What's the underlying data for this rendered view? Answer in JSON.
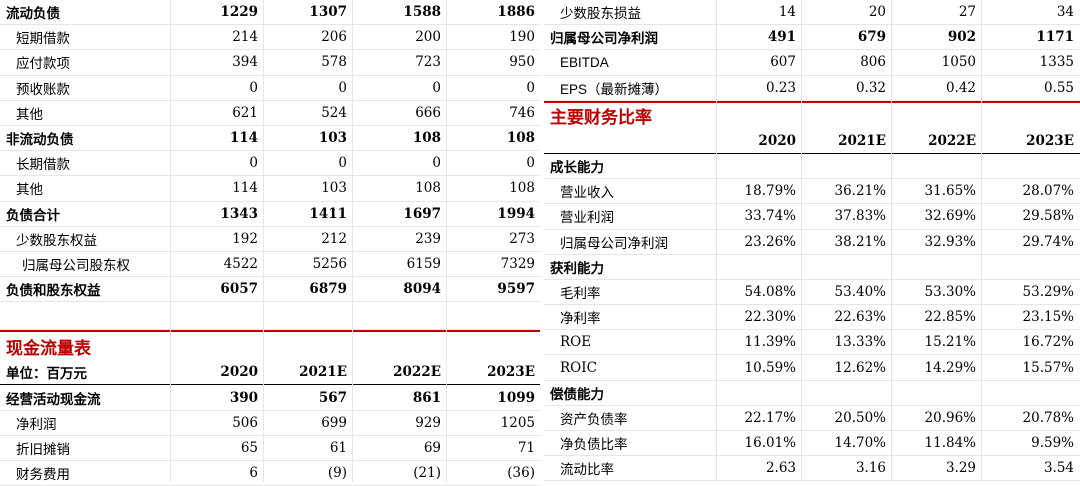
{
  "left": {
    "balance_rows": [
      {
        "label": "流动负债",
        "bold": true,
        "indent": 0,
        "values": [
          "1229",
          "1307",
          "1588",
          "1886"
        ]
      },
      {
        "label": "短期借款",
        "bold": false,
        "indent": 1,
        "values": [
          "214",
          "206",
          "200",
          "190"
        ]
      },
      {
        "label": "应付款项",
        "bold": false,
        "indent": 1,
        "values": [
          "394",
          "578",
          "723",
          "950"
        ]
      },
      {
        "label": "预收账款",
        "bold": false,
        "indent": 1,
        "values": [
          "0",
          "0",
          "0",
          "0"
        ]
      },
      {
        "label": "其他",
        "bold": false,
        "indent": 1,
        "values": [
          "621",
          "524",
          "666",
          "746"
        ]
      },
      {
        "label": "非流动负债",
        "bold": true,
        "indent": 0,
        "values": [
          "114",
          "103",
          "108",
          "108"
        ]
      },
      {
        "label": "长期借款",
        "bold": false,
        "indent": 1,
        "values": [
          "0",
          "0",
          "0",
          "0"
        ]
      },
      {
        "label": "其他",
        "bold": false,
        "indent": 1,
        "values": [
          "114",
          "103",
          "108",
          "108"
        ]
      },
      {
        "label": "负债合计",
        "bold": true,
        "indent": 0,
        "values": [
          "1343",
          "1411",
          "1697",
          "1994"
        ]
      },
      {
        "label": "少数股东权益",
        "bold": false,
        "indent": 1,
        "values": [
          "192",
          "212",
          "239",
          "273"
        ]
      },
      {
        "label": "归属母公司股东权",
        "bold": false,
        "indent": 2,
        "values": [
          "4522",
          "5256",
          "6159",
          "7329"
        ]
      },
      {
        "label": "负债和股东权益",
        "bold": true,
        "indent": 0,
        "values": [
          "6057",
          "6879",
          "8094",
          "9597"
        ]
      }
    ],
    "cashflow_title": "现金流量表",
    "cashflow_header": {
      "label": "单位：百万元",
      "years": [
        "2020",
        "2021E",
        "2022E",
        "2023E"
      ]
    },
    "cashflow_rows": [
      {
        "label": "经营活动现金流",
        "bold": true,
        "indent": 0,
        "values": [
          "390",
          "567",
          "861",
          "1099"
        ]
      },
      {
        "label": "净利润",
        "bold": false,
        "indent": 1,
        "values": [
          "506",
          "699",
          "929",
          "1205"
        ]
      },
      {
        "label": "折旧摊销",
        "bold": false,
        "indent": 1,
        "values": [
          "65",
          "61",
          "69",
          "71"
        ]
      },
      {
        "label": "财务费用",
        "bold": false,
        "indent": 1,
        "values": [
          "6",
          "(9)",
          "(21)",
          "(36)"
        ]
      }
    ]
  },
  "right": {
    "top_rows": [
      {
        "label": "少数股东损益",
        "bold": false,
        "indent": 1,
        "values": [
          "14",
          "20",
          "27",
          "34"
        ]
      },
      {
        "label": "归属母公司净利润",
        "bold": true,
        "indent": 0,
        "values": [
          "491",
          "679",
          "902",
          "1171"
        ]
      },
      {
        "label": "EBITDA",
        "bold": false,
        "indent": 1,
        "sans": true,
        "values": [
          "607",
          "806",
          "1050",
          "1335"
        ]
      },
      {
        "label": "EPS（最新摊薄）",
        "bold": false,
        "indent": 1,
        "sans": true,
        "values": [
          "0.23",
          "0.32",
          "0.42",
          "0.55"
        ]
      }
    ],
    "ratio_title": "主要财务比率",
    "ratio_years": [
      "2020",
      "2021E",
      "2022E",
      "2023E"
    ],
    "ratio_rows": [
      {
        "label": "成长能力",
        "bold": true,
        "indent": 0,
        "values": [
          "",
          "",
          "",
          ""
        ]
      },
      {
        "label": "营业收入",
        "bold": false,
        "indent": 1,
        "values": [
          "18.79%",
          "36.21%",
          "31.65%",
          "28.07%"
        ]
      },
      {
        "label": "营业利润",
        "bold": false,
        "indent": 1,
        "values": [
          "33.74%",
          "37.83%",
          "32.69%",
          "29.58%"
        ]
      },
      {
        "label": "归属母公司净利润",
        "bold": false,
        "indent": 1,
        "values": [
          "23.26%",
          "38.21%",
          "32.93%",
          "29.74%"
        ]
      },
      {
        "label": "获利能力",
        "bold": true,
        "indent": 0,
        "values": [
          "",
          "",
          "",
          ""
        ]
      },
      {
        "label": "毛利率",
        "bold": false,
        "indent": 1,
        "values": [
          "54.08%",
          "53.40%",
          "53.30%",
          "53.29%"
        ]
      },
      {
        "label": "净利率",
        "bold": false,
        "indent": 1,
        "values": [
          "22.30%",
          "22.63%",
          "22.85%",
          "23.15%"
        ]
      },
      {
        "label": "ROE",
        "bold": false,
        "indent": 1,
        "values": [
          "11.39%",
          "13.33%",
          "15.21%",
          "16.72%"
        ]
      },
      {
        "label": "ROIC",
        "bold": false,
        "indent": 1,
        "values": [
          "10.59%",
          "12.62%",
          "14.29%",
          "15.57%"
        ]
      },
      {
        "label": "偿债能力",
        "bold": true,
        "indent": 0,
        "values": [
          "",
          "",
          "",
          ""
        ]
      },
      {
        "label": "资产负债率",
        "bold": false,
        "indent": 1,
        "values": [
          "22.17%",
          "20.50%",
          "20.96%",
          "20.78%"
        ]
      },
      {
        "label": "净负债比率",
        "bold": false,
        "indent": 1,
        "values": [
          "16.01%",
          "14.70%",
          "11.84%",
          "9.59%"
        ]
      },
      {
        "label": "流动比率",
        "bold": false,
        "indent": 1,
        "values": [
          "2.63",
          "3.16",
          "3.29",
          "3.54"
        ]
      }
    ]
  }
}
